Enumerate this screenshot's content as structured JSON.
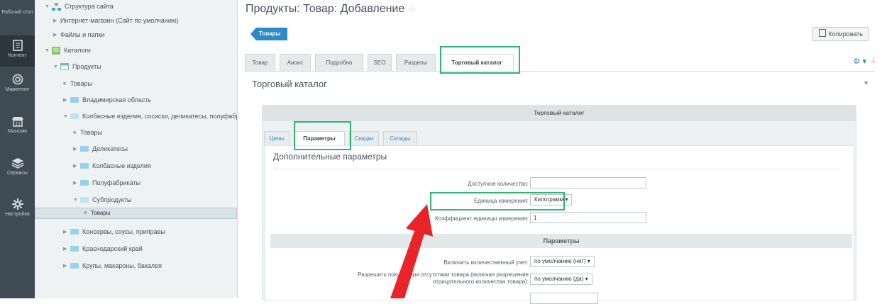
{
  "leftbar": {
    "items": [
      {
        "label": "Рабочий стол",
        "icon": "desktop-icon"
      },
      {
        "label": "Контент",
        "icon": "content-icon",
        "active": true
      },
      {
        "label": "Маркетинг",
        "icon": "target-icon"
      },
      {
        "label": "Магазин",
        "icon": "shop-icon"
      },
      {
        "label": "Сервисы",
        "icon": "layers-icon"
      },
      {
        "label": "Настройки",
        "icon": "gear-icon"
      }
    ]
  },
  "tree": {
    "items": [
      {
        "label": "Структура сайта"
      },
      {
        "label": "Интернет-магазин (Сайт по умолчанию)"
      },
      {
        "label": "Файлы и папки"
      },
      {
        "label": "Каталоги"
      },
      {
        "label": "Продукты"
      },
      {
        "label": "Товары"
      },
      {
        "label": "Владимирская область"
      },
      {
        "label": "Колбасные изделия, сосиски, деликатесы, полуфабри"
      },
      {
        "label": "Товары"
      },
      {
        "label": "Деликатесы"
      },
      {
        "label": "Колбасные изделия"
      },
      {
        "label": "Полуфабрикаты"
      },
      {
        "label": "Субпродукты"
      },
      {
        "label": "Товары"
      },
      {
        "label": "Консервы, соусы, приправы"
      },
      {
        "label": "Краснодарский край"
      },
      {
        "label": "Крупы, макароны, бакалея"
      }
    ]
  },
  "page": {
    "title": "Продукты: Товар: Добавление",
    "back_label": "Товары",
    "copy_label": "Копировать"
  },
  "tabs": [
    {
      "label": "Товар"
    },
    {
      "label": "Анонс"
    },
    {
      "label": "Подробно"
    },
    {
      "label": "SEO"
    },
    {
      "label": "Разделы"
    },
    {
      "label": "Торговый каталог"
    }
  ],
  "section": {
    "title": "Торговый каталог",
    "panel_title": "Торговый каталог"
  },
  "subtabs": [
    {
      "label": "Цены"
    },
    {
      "label": "Параметры"
    },
    {
      "label": "Скидки"
    },
    {
      "label": "Склады"
    }
  ],
  "form": {
    "title": "Дополнительные параметры",
    "available_qty_label": "Доступное количество:",
    "available_qty_value": "",
    "unit_label": "Единица измерения:",
    "unit_value": "Килограмм",
    "coef_label": "Коэффициент единицы измерения:",
    "coef_value": "1",
    "params_title": "Параметры",
    "qty_accounting_label": "Включить количественный учет:",
    "qty_accounting_value": "по умолчанию (нет)",
    "allow_buy_label_1": "Разрешить покупку при отсутствии товара (включая разрешение",
    "allow_buy_label_2": "отрицательного количества товара):",
    "allow_buy_value": "по умолчанию (да)"
  },
  "colors": {
    "accent": "#2d8ac6",
    "highlight": "#2bb673",
    "arrow": "#e8232a",
    "sidebar_bg": "#3f4b54"
  }
}
